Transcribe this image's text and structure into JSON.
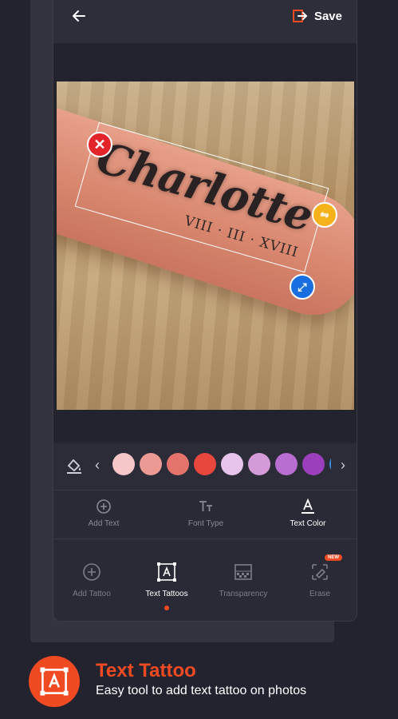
{
  "header": {
    "back_icon": "arrow-left-icon",
    "save_label": "Save",
    "save_icon": "exit-icon"
  },
  "tattoo": {
    "name": "Charlotte",
    "date": "VIII · III · XVIII",
    "handles": [
      "close-icon",
      "flip-icon",
      "resize-icon"
    ]
  },
  "palette": {
    "colors": [
      "#f7c6c8",
      "#ec9a94",
      "#e3736b",
      "#e8473d",
      "#e6c4ec",
      "#d59ad8",
      "#b86dd0",
      "#9c3fbc",
      "#3b8be0"
    ]
  },
  "sub_toolbar": {
    "items": [
      {
        "label": "Add Text",
        "icon": "add-circle-icon",
        "active": false
      },
      {
        "label": "Font Type",
        "icon": "font-size-icon",
        "active": false
      },
      {
        "label": "Text Color",
        "icon": "text-color-icon",
        "active": true
      }
    ]
  },
  "main_toolbar": {
    "items": [
      {
        "label": "Add Tattoo",
        "icon": "add-circle-icon",
        "active": false
      },
      {
        "label": "Text Tattoos",
        "icon": "text-frame-icon",
        "active": true
      },
      {
        "label": "Transparency",
        "icon": "transparency-icon",
        "active": false
      },
      {
        "label": "Erase",
        "icon": "eraser-icon",
        "active": false,
        "badge": "NEW"
      }
    ]
  },
  "promo": {
    "title": "Text Tattoo",
    "subtitle": "Easy tool to add text tattoo on photos"
  },
  "colors": {
    "accent": "#f04a23",
    "background": "#232330",
    "panel": "#2a2a36"
  }
}
